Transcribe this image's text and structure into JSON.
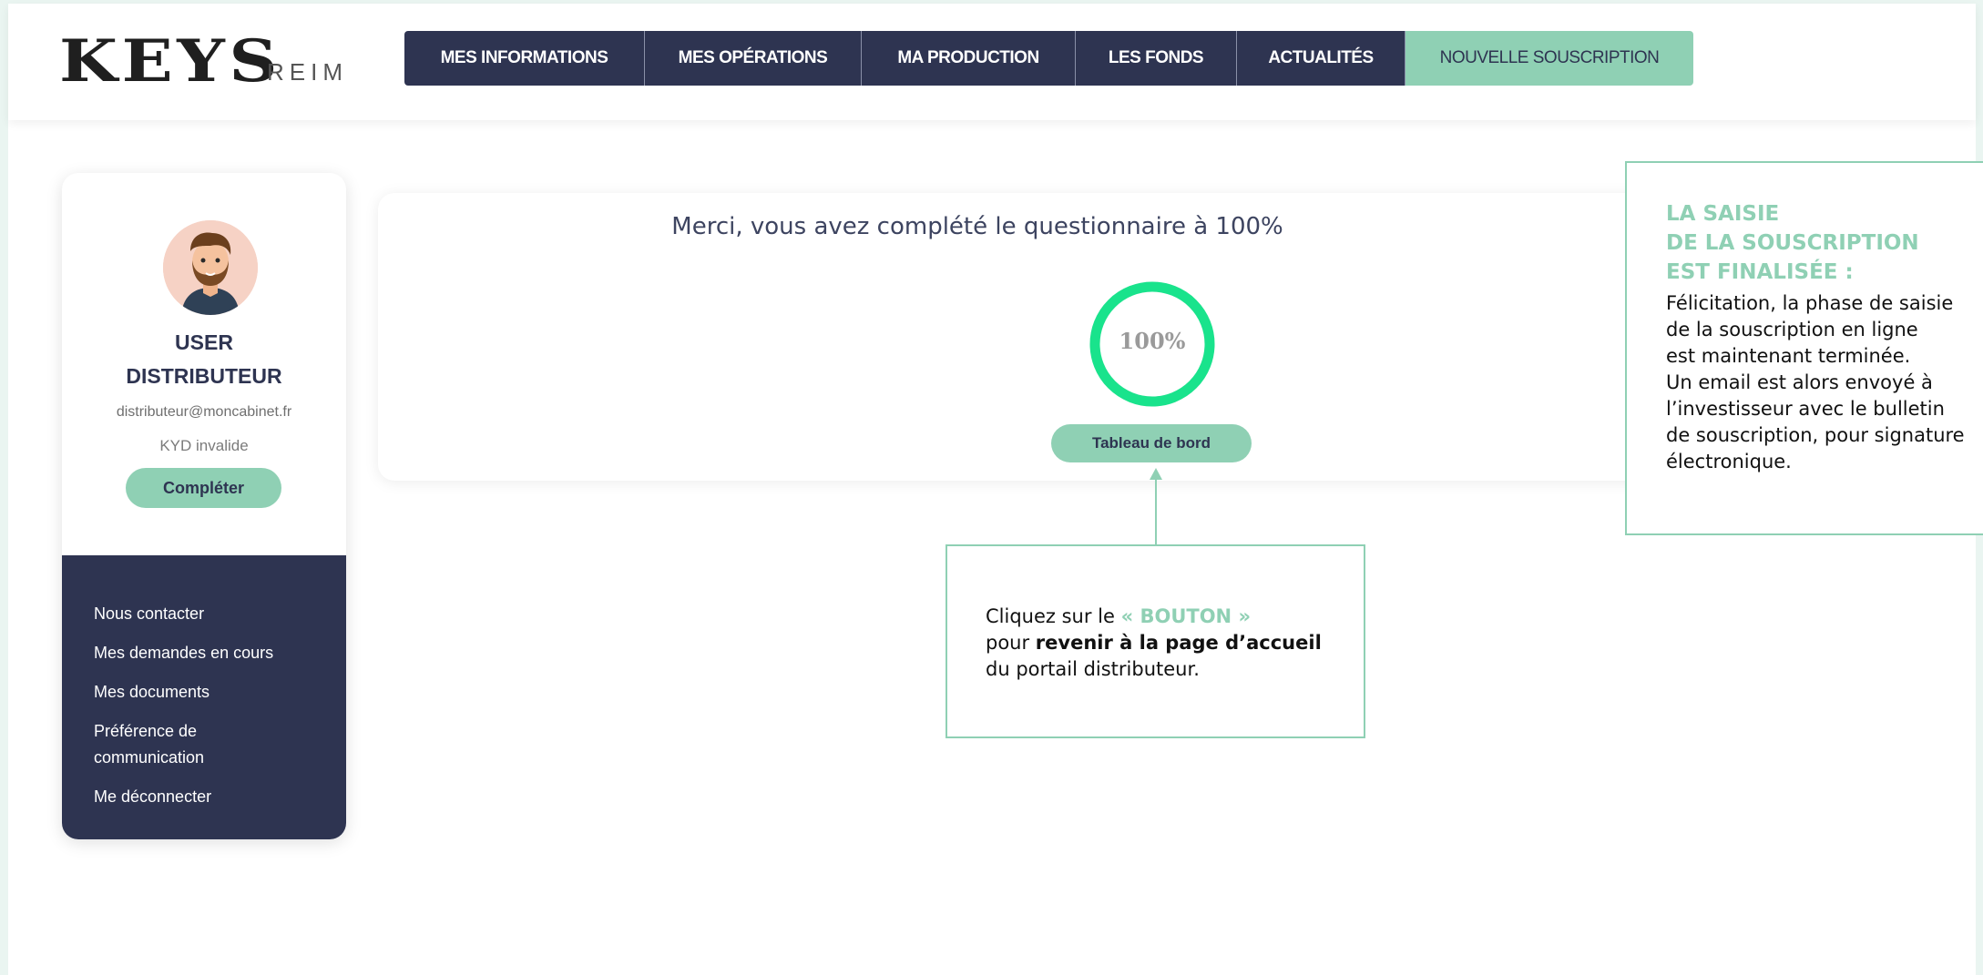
{
  "header": {
    "logo_main": "KEYS",
    "logo_sub": "REIM",
    "nav": [
      {
        "label": "MES INFORMATIONS"
      },
      {
        "label": "MES OPÉRATIONS"
      },
      {
        "label": "MA PRODUCTION"
      },
      {
        "label": "LES FONDS"
      },
      {
        "label": "ACTUALITÉS"
      },
      {
        "label": "NOUVELLE SOUSCRIPTION"
      }
    ]
  },
  "profile": {
    "name_line1": "USER",
    "name_line2": "DISTRIBUTEUR",
    "email": "distributeur@moncabinet.fr",
    "kyd_status": "KYD invalide",
    "complete_button": "Compléter"
  },
  "side_menu": [
    {
      "label": "Nous contacter"
    },
    {
      "label": "Mes demandes en cours"
    },
    {
      "label": "Mes documents"
    },
    {
      "label": "Préférence de"
    },
    {
      "label": "communication"
    },
    {
      "label": "Me déconnecter"
    }
  ],
  "main": {
    "message": "Merci, vous avez complété le questionnaire à 100%",
    "progress_label": "100%",
    "progress_value": 100,
    "dashboard_button": "Tableau de bord"
  },
  "callout": {
    "part1": "Cliquez sur le ",
    "highlight": "« BOUTON »",
    "part2": "pour ",
    "bold": "revenir à la page d’accueil",
    "part3": "du portail distributeur."
  },
  "info_box": {
    "title": "LA SAISIE\nDE LA SOUSCRIPTION\nEST FINALISÉE :",
    "body": "Félicitation, la phase de saisie\nde la souscription en ligne\nest maintenant terminée.\nUn email est alors envoyé à\nl’investisseur avec le bulletin\nde souscription, pour signature\nélectronique."
  },
  "colors": {
    "navy": "#2e3451",
    "accent": "#8fd0b4",
    "gauge": "#19e38c"
  }
}
